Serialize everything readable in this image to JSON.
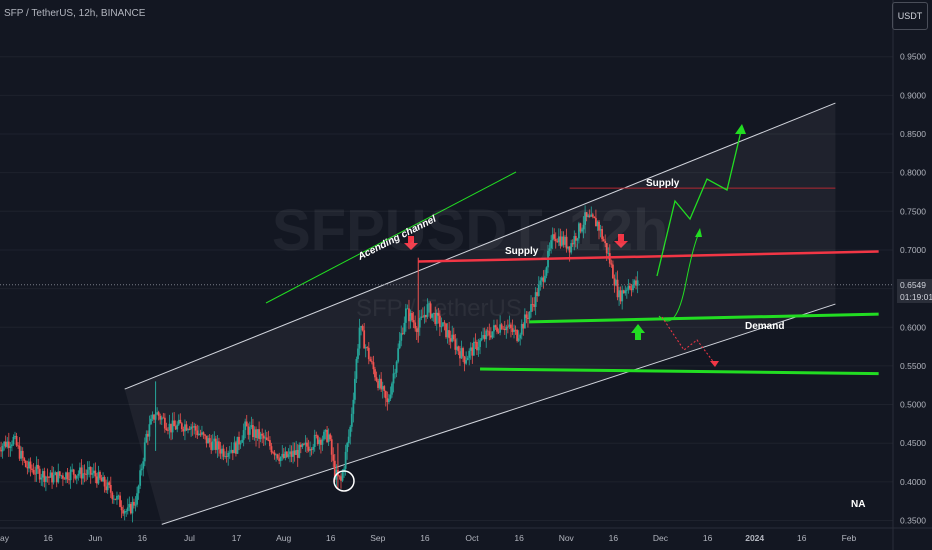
{
  "header": {
    "pair_title": "SFP / TetherUS, 12h, BINANCE",
    "currency_button": "USDT"
  },
  "price_tag": {
    "price": "0.6549",
    "countdown": "01:19:01"
  },
  "watermark": {
    "symbol": "SFPUSDT, 12h",
    "name": "SFP / TetherUS"
  },
  "annotations": {
    "channel_label": "Acending channel",
    "supply_upper": "Supply",
    "supply_lower": "Supply",
    "demand": "Demand",
    "corner": "NA"
  },
  "colors": {
    "background": "#131722",
    "up_candle": "#26a69a",
    "down_candle": "#ef5350",
    "supply_line": "#f23645",
    "demand_line": "#22dd22",
    "channel": "#d1d4dc",
    "arrow_red": "#f23645",
    "arrow_green": "#22dd22"
  },
  "chart_data": {
    "type": "candlestick",
    "title": "SFP / TetherUS, 12h, BINANCE",
    "x_ticks": [
      "May",
      "16",
      "Jun",
      "16",
      "Jul",
      "17",
      "Aug",
      "16",
      "Sep",
      "16",
      "Oct",
      "16",
      "Nov",
      "16",
      "Dec",
      "16",
      "2024",
      "16",
      "Feb"
    ],
    "y_ticks": [
      "0.9500",
      "0.9000",
      "0.8500",
      "0.8000",
      "0.7500",
      "0.7000",
      "0.6500",
      "0.6000",
      "0.5500",
      "0.5000",
      "0.4500",
      "0.4000",
      "0.3500"
    ],
    "ylim": [
      0.345,
      0.98
    ],
    "x_range": [
      "2023-05-01",
      "2024-02-08"
    ],
    "current_price": 0.6549,
    "price_path": [
      {
        "date": "2023-05-01",
        "price": 0.445
      },
      {
        "date": "2023-05-06",
        "price": 0.455
      },
      {
        "date": "2023-05-10",
        "price": 0.42
      },
      {
        "date": "2023-05-18",
        "price": 0.405
      },
      {
        "date": "2023-05-25",
        "price": 0.412
      },
      {
        "date": "2023-06-01",
        "price": 0.41
      },
      {
        "date": "2023-06-06",
        "price": 0.39
      },
      {
        "date": "2023-06-10",
        "price": 0.37
      },
      {
        "date": "2023-06-12",
        "price": 0.36
      },
      {
        "date": "2023-06-15",
        "price": 0.38
      },
      {
        "date": "2023-06-18",
        "price": 0.46
      },
      {
        "date": "2023-06-21",
        "price": 0.49
      },
      {
        "date": "2023-06-26",
        "price": 0.47
      },
      {
        "date": "2023-07-02",
        "price": 0.475
      },
      {
        "date": "2023-07-07",
        "price": 0.455
      },
      {
        "date": "2023-07-13",
        "price": 0.44
      },
      {
        "date": "2023-07-17",
        "price": 0.445
      },
      {
        "date": "2023-07-20",
        "price": 0.47
      },
      {
        "date": "2023-07-26",
        "price": 0.455
      },
      {
        "date": "2023-08-01",
        "price": 0.43
      },
      {
        "date": "2023-08-07",
        "price": 0.44
      },
      {
        "date": "2023-08-12",
        "price": 0.455
      },
      {
        "date": "2023-08-16",
        "price": 0.46
      },
      {
        "date": "2023-08-18",
        "price": 0.41
      },
      {
        "date": "2023-08-20",
        "price": 0.4
      },
      {
        "date": "2023-08-23",
        "price": 0.47
      },
      {
        "date": "2023-08-26",
        "price": 0.6
      },
      {
        "date": "2023-08-30",
        "price": 0.55
      },
      {
        "date": "2023-09-04",
        "price": 0.5
      },
      {
        "date": "2023-09-07",
        "price": 0.56
      },
      {
        "date": "2023-09-10",
        "price": 0.62
      },
      {
        "date": "2023-09-14",
        "price": 0.6
      },
      {
        "date": "2023-09-17",
        "price": 0.625
      },
      {
        "date": "2023-09-22",
        "price": 0.6
      },
      {
        "date": "2023-09-29",
        "price": 0.56
      },
      {
        "date": "2023-10-05",
        "price": 0.585
      },
      {
        "date": "2023-10-11",
        "price": 0.605
      },
      {
        "date": "2023-10-16",
        "price": 0.59
      },
      {
        "date": "2023-10-20",
        "price": 0.62
      },
      {
        "date": "2023-10-24",
        "price": 0.66
      },
      {
        "date": "2023-10-28",
        "price": 0.72
      },
      {
        "date": "2023-11-02",
        "price": 0.705
      },
      {
        "date": "2023-11-07",
        "price": 0.74
      },
      {
        "date": "2023-11-11",
        "price": 0.735
      },
      {
        "date": "2023-11-14",
        "price": 0.7
      },
      {
        "date": "2023-11-18",
        "price": 0.64
      },
      {
        "date": "2023-11-21",
        "price": 0.655
      },
      {
        "date": "2023-11-24",
        "price": 0.6549
      }
    ],
    "markers": [
      {
        "label": "Supply",
        "level": 0.78,
        "from": "2023-11-02",
        "to": "2024-01-27"
      },
      {
        "label": "Supply",
        "level_start": 0.685,
        "level_end": 0.698,
        "from": "2023-09-14",
        "to": "2024-02-10"
      },
      {
        "label": "Demand",
        "level_start": 0.607,
        "level_end": 0.617,
        "from": "2023-10-20",
        "to": "2024-02-10"
      },
      {
        "label": "",
        "level_start": 0.546,
        "level_end": 0.54,
        "from": "2023-10-04",
        "to": "2024-02-10"
      }
    ],
    "channel": {
      "upper": [
        {
          "date": "2023-06-11",
          "price": 0.52
        },
        {
          "date": "2024-01-27",
          "price": 0.89
        }
      ],
      "lower": [
        {
          "date": "2023-06-23",
          "price": 0.345
        },
        {
          "date": "2024-01-27",
          "price": 0.63
        }
      ]
    }
  }
}
